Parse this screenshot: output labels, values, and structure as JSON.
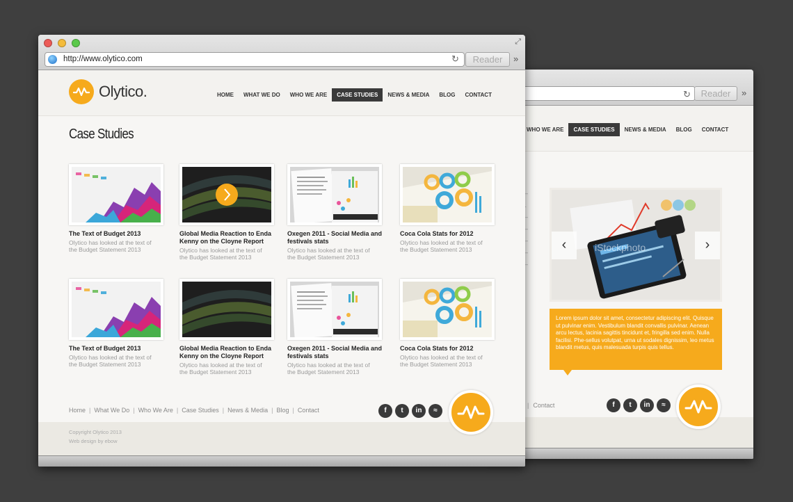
{
  "back_window": {
    "reader_label": "Reader",
    "nav": [
      "WHO WE ARE",
      "CASE STUDIES",
      "NEWS & MEDIA",
      "BLOG",
      "CONTACT"
    ],
    "active_nav": "CASE STUDIES",
    "slider_watermark": "iStockphoto",
    "caption": "Lorem ipsum dolor sit amet, consectetur adipiscing elit. Quisque ut pulvinar enim. Vestibulum blandit convallis pulvinar. Aenean arcu lectus, lacinia sagittis tincidunt et, fringilla sed enim. Nulla facilisi. Phe-sellus volutpat, urna ut sodales dignissim, leo metus blandit metus, quis malesuada turpis quis tellus.",
    "footer_link": "Contact"
  },
  "front_window": {
    "url": "http://www.olytico.com",
    "reader_label": "Reader",
    "brand": "Olytico.",
    "nav": [
      "HOME",
      "WHAT WE DO",
      "WHO WE ARE",
      "CASE STUDIES",
      "NEWS & MEDIA",
      "BLOG",
      "CONTACT"
    ],
    "active_nav": "CASE STUDIES",
    "page_title": "Case Studies",
    "cards": [
      {
        "title": "The Text of Budget 2013",
        "desc": "Olytico has looked at the text of the Budget Statement 2013",
        "thumb": "budget"
      },
      {
        "title": "Global Media Reaction to Enda Kenny on the Cloyne Report",
        "desc": "Olytico has looked at the text of the Budget Statement 2013",
        "thumb": "dark"
      },
      {
        "title": "Oxegen 2011 - Social Media and festivals stats",
        "desc": "Olytico has looked at the text of the Budget Statement 2013",
        "thumb": "oxegen"
      },
      {
        "title": "Coca Cola Stats for 2012",
        "desc": "Olytico has looked at the text of the Budget Statement 2013",
        "thumb": "coke"
      },
      {
        "title": "The Text of Budget 2013",
        "desc": "Olytico has looked at the text of the Budget Statement 2013",
        "thumb": "budget"
      },
      {
        "title": "Global Media Reaction to Enda Kenny on the Cloyne Report",
        "desc": "Olytico has looked at the text of the Budget Statement 2013",
        "thumb": "dark"
      },
      {
        "title": "Oxegen 2011 - Social Media and festivals stats",
        "desc": "Olytico has looked at the text of the Budget Statement 2013",
        "thumb": "oxegen"
      },
      {
        "title": "Coca Cola Stats for 2012",
        "desc": "Olytico has looked at the text of the Budget Statement 2013",
        "thumb": "coke"
      }
    ],
    "footer_links": [
      "Home",
      "What We Do",
      "Who We Are",
      "Case Studies",
      "News & Media",
      "Blog",
      "Contact"
    ],
    "social_icons": [
      "facebook-icon",
      "twitter-icon",
      "linkedin-icon",
      "rss-icon"
    ],
    "copyright": "Copyright Olytico 2013",
    "credit": "Web design by ebow"
  },
  "colors": {
    "accent": "#f6aa1c",
    "nav_active_bg": "#3a3a3a",
    "page_bg": "#3f3f3f"
  }
}
